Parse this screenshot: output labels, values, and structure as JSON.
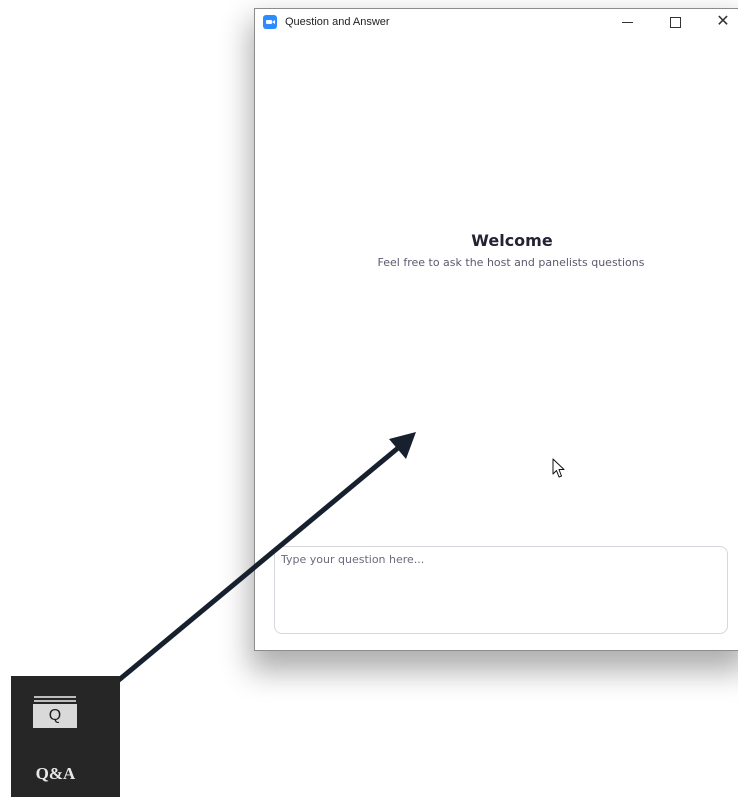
{
  "window": {
    "title": "Question and Answer",
    "controls": {
      "minimize_icon": "minimize-icon",
      "maximize_icon": "maximize-icon",
      "close_icon": "close-icon",
      "close_glyph": "✕"
    },
    "app_icon": "zoom-app-icon"
  },
  "welcome": {
    "title": "Welcome",
    "subtitle": "Feel free to ask the host and panelists questions"
  },
  "question": {
    "placeholder": "Type your question here...",
    "value": ""
  },
  "toolbar": {
    "qa_button": {
      "icon_letter": "Q",
      "label": "Q&A",
      "icon": "qa-icon"
    }
  },
  "colors": {
    "accent": "#2d8cff",
    "toolbar_bg": "#262626",
    "arrow": "#17202e",
    "welcome_title": "#232333"
  }
}
